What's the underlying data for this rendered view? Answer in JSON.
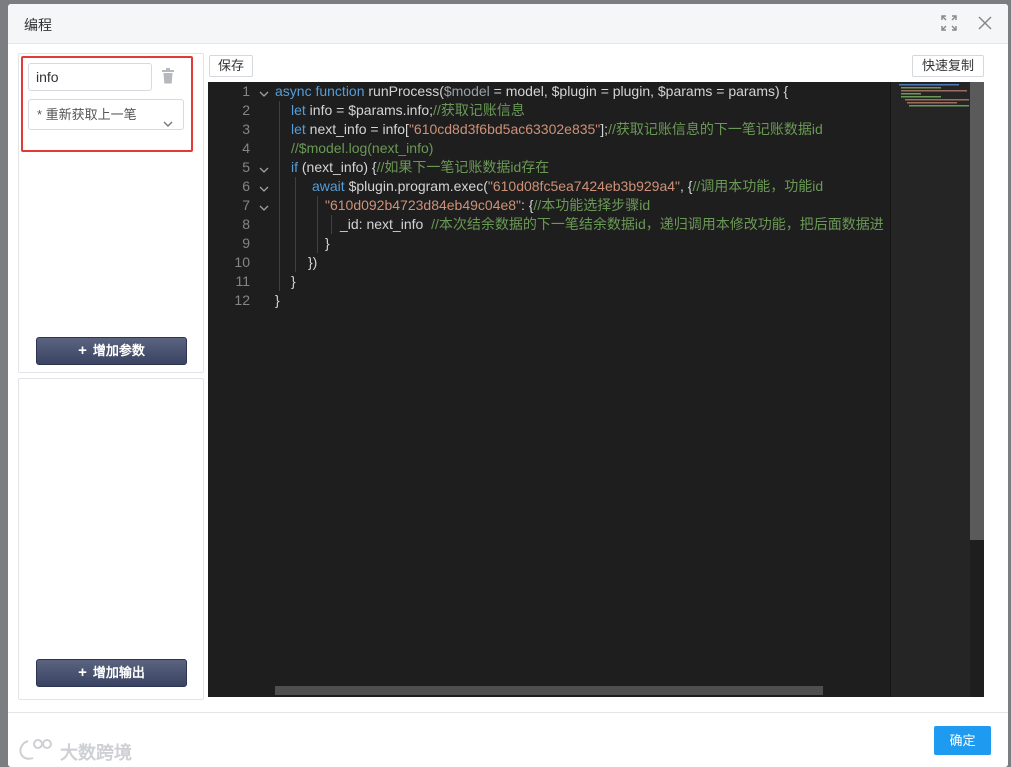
{
  "dialog": {
    "title": "编程",
    "maximize_icon": "maximize-icon",
    "close_icon": "close-icon"
  },
  "params": {
    "input_value": "info",
    "select_value": "* 重新获取上一笔",
    "add_param_label": "增加参数",
    "add_output_label": "增加输出"
  },
  "toolbar": {
    "save_label": "保存",
    "quick_copy_label": "快速复制"
  },
  "editor": {
    "line_numbers": [
      "1",
      "2",
      "3",
      "4",
      "5",
      "6",
      "7",
      "8",
      "9",
      "10",
      "11",
      "12"
    ],
    "lines": [
      {
        "t1": "async function",
        "t2": " runProcess(",
        "t3": "$model",
        "t4": " = model, $plugin = plugin, $params = params) {"
      },
      {
        "t1": "let",
        "t2": " info = $params.info;",
        "t3": "//获取记账信息"
      },
      {
        "t1": "let",
        "t2": " next_info = info[",
        "t3": "\"610cd8d3f6bd5ac63302e835\"",
        "t4": "];",
        "t5": "//获取记账信息的下一笔记账数据id"
      },
      {
        "t1": "//$model.log(next_info)"
      },
      {
        "t1": "if",
        "t2": " (next_info) {",
        "t3": "//如果下一笔记账数据id存在"
      },
      {
        "t1": "await",
        "t2": " $plugin.program.exec(",
        "t3": "\"610d08fc5ea7424eb3b929a4\"",
        "t4": ", {",
        "t5": "//调用本功能，功能id"
      },
      {
        "t1": "\"610d092b4723d84eb49c04e8\"",
        "t2": ": {",
        "t3": "//本功能选择步骤id"
      },
      {
        "t1": "_id: next_info",
        "t2": "  //本次结余数据的下一笔结余数据id，递归调用本修改功能，把后面数据进"
      },
      {
        "t1": "}"
      },
      {
        "t1": "})"
      },
      {
        "t1": "}"
      },
      {
        "t1": "}"
      }
    ]
  },
  "footer": {
    "ok_label": "确定"
  },
  "watermark": {
    "text": "大数跨境"
  },
  "colors": {
    "primary": "#1e9bf0",
    "navy_button": "#3a4462",
    "highlight_border": "#e53935",
    "editor_bg": "#1e1e1e"
  }
}
